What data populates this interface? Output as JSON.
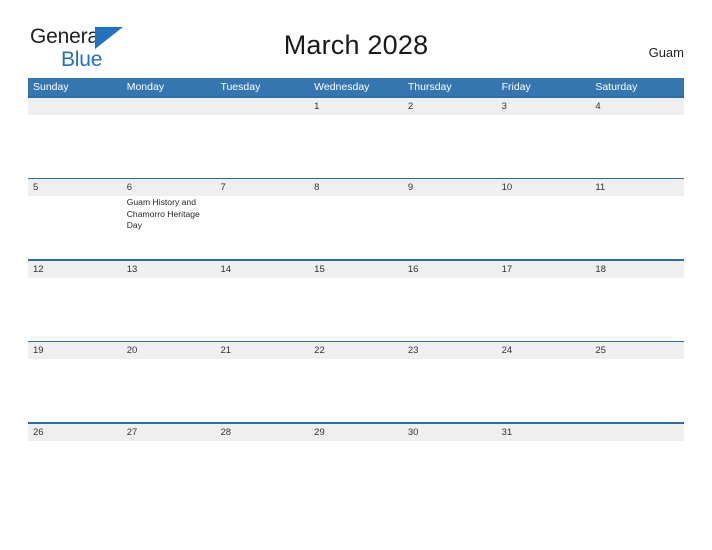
{
  "brand": {
    "name_part1": "General",
    "name_part2": "Blue",
    "accent_color": "#2073bc"
  },
  "header": {
    "title": "March 2028",
    "region": "Guam"
  },
  "calendar": {
    "month": "March",
    "year": "2028",
    "header_color": "#3576b0",
    "rule_color": "#2e6da4",
    "day_band_color": "#efefef",
    "weekdays": [
      "Sunday",
      "Monday",
      "Tuesday",
      "Wednesday",
      "Thursday",
      "Friday",
      "Saturday"
    ],
    "weeks": [
      {
        "days": [
          {
            "date": "",
            "events": []
          },
          {
            "date": "",
            "events": []
          },
          {
            "date": "",
            "events": []
          },
          {
            "date": "1",
            "events": []
          },
          {
            "date": "2",
            "events": []
          },
          {
            "date": "3",
            "events": []
          },
          {
            "date": "4",
            "events": []
          }
        ]
      },
      {
        "days": [
          {
            "date": "5",
            "events": []
          },
          {
            "date": "6",
            "events": [
              "Guam History and Chamorro Heritage Day"
            ]
          },
          {
            "date": "7",
            "events": []
          },
          {
            "date": "8",
            "events": []
          },
          {
            "date": "9",
            "events": []
          },
          {
            "date": "10",
            "events": []
          },
          {
            "date": "11",
            "events": []
          }
        ]
      },
      {
        "days": [
          {
            "date": "12",
            "events": []
          },
          {
            "date": "13",
            "events": []
          },
          {
            "date": "14",
            "events": []
          },
          {
            "date": "15",
            "events": []
          },
          {
            "date": "16",
            "events": []
          },
          {
            "date": "17",
            "events": []
          },
          {
            "date": "18",
            "events": []
          }
        ]
      },
      {
        "days": [
          {
            "date": "19",
            "events": []
          },
          {
            "date": "20",
            "events": []
          },
          {
            "date": "21",
            "events": []
          },
          {
            "date": "22",
            "events": []
          },
          {
            "date": "23",
            "events": []
          },
          {
            "date": "24",
            "events": []
          },
          {
            "date": "25",
            "events": []
          }
        ]
      },
      {
        "days": [
          {
            "date": "26",
            "events": []
          },
          {
            "date": "27",
            "events": []
          },
          {
            "date": "28",
            "events": []
          },
          {
            "date": "29",
            "events": []
          },
          {
            "date": "30",
            "events": []
          },
          {
            "date": "31",
            "events": []
          },
          {
            "date": "",
            "events": []
          }
        ]
      }
    ]
  }
}
